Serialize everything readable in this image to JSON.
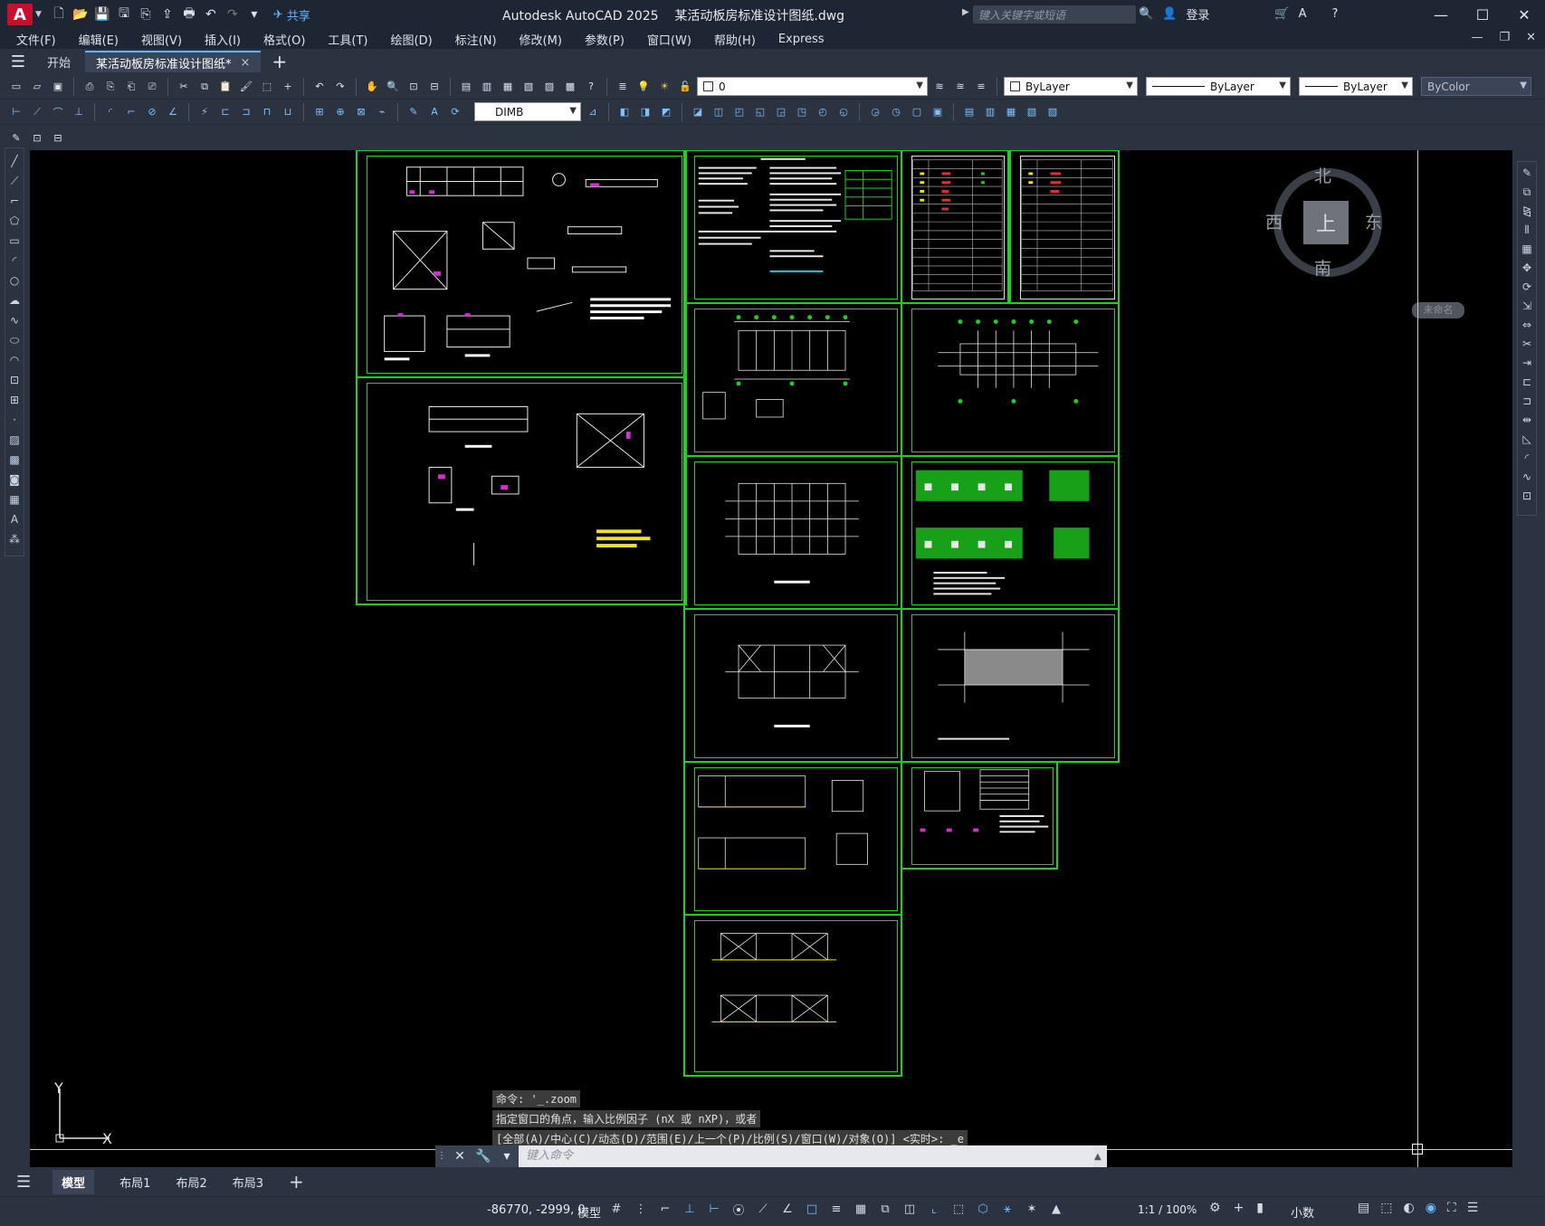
{
  "app": {
    "logo": "A",
    "title": "Autodesk AutoCAD 2025    某活动板房标准设计图纸.dwg",
    "share_label": "共享",
    "search_placeholder": "键入关键字或短语",
    "signin_label": "登录"
  },
  "menu": [
    "文件(F)",
    "编辑(E)",
    "视图(V)",
    "插入(I)",
    "格式(O)",
    "工具(T)",
    "绘图(D)",
    "标注(N)",
    "修改(M)",
    "参数(P)",
    "窗口(W)",
    "帮助(H)",
    "Express"
  ],
  "tabs": {
    "start": "开始",
    "doc": "某活动板房标准设计图纸*",
    "close": "×",
    "new": "+"
  },
  "properties": {
    "layer": "0",
    "color": "ByLayer",
    "linetype": "ByLayer",
    "lineweight": "ByLayer",
    "plotstyle": "ByColor",
    "dimstyle": "DIMB"
  },
  "viewcube": {
    "north": "北",
    "south": "南",
    "east": "东",
    "west": "西",
    "top": "上",
    "wcs": "未命名"
  },
  "ucs": {
    "x": "X",
    "y": "Y"
  },
  "command": {
    "history": [
      "命令: '_.zoom",
      "指定窗口的角点，输入比例因子 (nX 或 nXP)，或者",
      "[全部(A)/中心(C)/动态(D)/范围(E)/上一个(P)/比例(S)/窗口(W)/对象(O)] <实时>: _e"
    ],
    "placeholder": "键入命令"
  },
  "layouts": [
    "模型",
    "布局1",
    "布局2",
    "布局3"
  ],
  "status": {
    "coords": "-86770, -2999, 0",
    "model": "模型",
    "scale": "1:1 / 100%",
    "units": "小数"
  },
  "colors": {
    "drawing_green": "#1fd11f",
    "accent_blue": "#5fb3ff",
    "background": "#000000"
  }
}
